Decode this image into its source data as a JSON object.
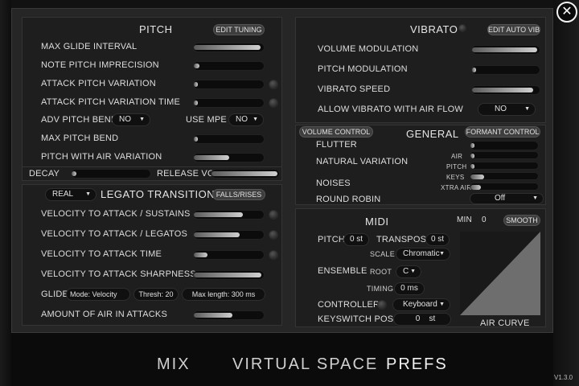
{
  "pitch": {
    "title": "PITCH",
    "edit_tuning": "EDIT TUNING",
    "rows": [
      {
        "label": "MAX GLIDE INTERVAL",
        "value": 0.95
      },
      {
        "label": "NOTE PITCH IMPRECISION",
        "value": 0.08
      },
      {
        "label": "ATTACK PITCH VARIATION",
        "value": 0.06
      },
      {
        "label": "ATTACK PITCH VARIATION TIME",
        "value": 0.06
      }
    ],
    "adv_pitch_bend": {
      "label": "ADV PITCH BEND",
      "value": "NO"
    },
    "use_mpe": {
      "label": "USE MPE",
      "value": "NO"
    },
    "rows2": [
      {
        "label": "MAX PITCH BEND",
        "value": 0.06
      },
      {
        "label": "PITCH WITH AIR VARIATION",
        "value": 0.5
      }
    ]
  },
  "decay": {
    "label": "DECAY",
    "value": 0.05
  },
  "release": {
    "label": "RELEASE VOL",
    "value": 0.98
  },
  "legato": {
    "mode": "REAL",
    "title": "LEGATO TRANSITIONS",
    "falls_rises": "FALLS/RISES",
    "rows": [
      {
        "label": "VELOCITY TO ATTACK / SUSTAINS",
        "value": 0.7
      },
      {
        "label": "VELOCITY TO ATTACK / LEGATOS",
        "value": 0.65
      },
      {
        "label": "VELOCITY TO ATTACK TIME",
        "value": 0.2
      },
      {
        "label": "VELOCITY TO ATTACK SHARPNESS",
        "value": 0.97
      }
    ],
    "glide": {
      "label": "GLIDE",
      "mode": "Mode: Velocity",
      "thresh": "Thresh: 20",
      "max_length": "Max length:  300 ms"
    },
    "air": {
      "label": "AMOUNT OF AIR IN ATTACKS",
      "value": 0.55
    }
  },
  "vibrato": {
    "title": "VIBRATO",
    "edit_auto": "EDIT AUTO VIB",
    "rows": [
      {
        "label": "VOLUME MODULATION",
        "value": 0.97
      },
      {
        "label": "PITCH MODULATION",
        "value": 0.05
      },
      {
        "label": "VIBRATO SPEED",
        "value": 0.9
      }
    ],
    "air_flow": {
      "label": "ALLOW VIBRATO WITH AIR FLOW",
      "value": "NO"
    }
  },
  "general": {
    "volume_control": "VOLUME CONTROL",
    "title": "GENERAL",
    "formant_control": "FORMANT CONTROL",
    "flutter": {
      "label": "FLUTTER",
      "value": 0.05
    },
    "natural_variation": "NATURAL VARIATION",
    "air": {
      "label": "AIR",
      "value": 0.05
    },
    "pitch": {
      "label": "PITCH",
      "value": 0.05
    },
    "noises": "NOISES",
    "keys": {
      "label": "KEYS",
      "value": 0.2
    },
    "xtra_air": {
      "label": "XTRA AIR",
      "value": 0.15
    },
    "round_robin": {
      "label": "ROUND ROBIN",
      "value": "Off"
    }
  },
  "midi": {
    "title": "MIDI",
    "pitch": {
      "label": "PITCH",
      "value": "0 st"
    },
    "transpose": {
      "label": "TRANSPOSE",
      "value": "0 st"
    },
    "ensemble": "ENSEMBLE",
    "scale": {
      "label": "SCALE",
      "value": "Chromatic"
    },
    "root": {
      "label": "ROOT",
      "value": "C"
    },
    "timing": {
      "label": "TIMING",
      "value": "0 ms"
    },
    "controller": {
      "label": "CONTROLLER",
      "value": "Keyboard"
    },
    "keyswitch": {
      "label": "KEYSWITCH POS",
      "value": "0",
      "unit": "st"
    },
    "min_label": "MIN",
    "min_value": "0",
    "smooth": "SMOOTH",
    "air_curve": "AIR CURVE"
  },
  "tabs": {
    "mix": "MIX",
    "virtual_space": "VIRTUAL SPACE",
    "prefs": "PREFS"
  },
  "close_glyph": "✕",
  "version": "V1.3.0"
}
